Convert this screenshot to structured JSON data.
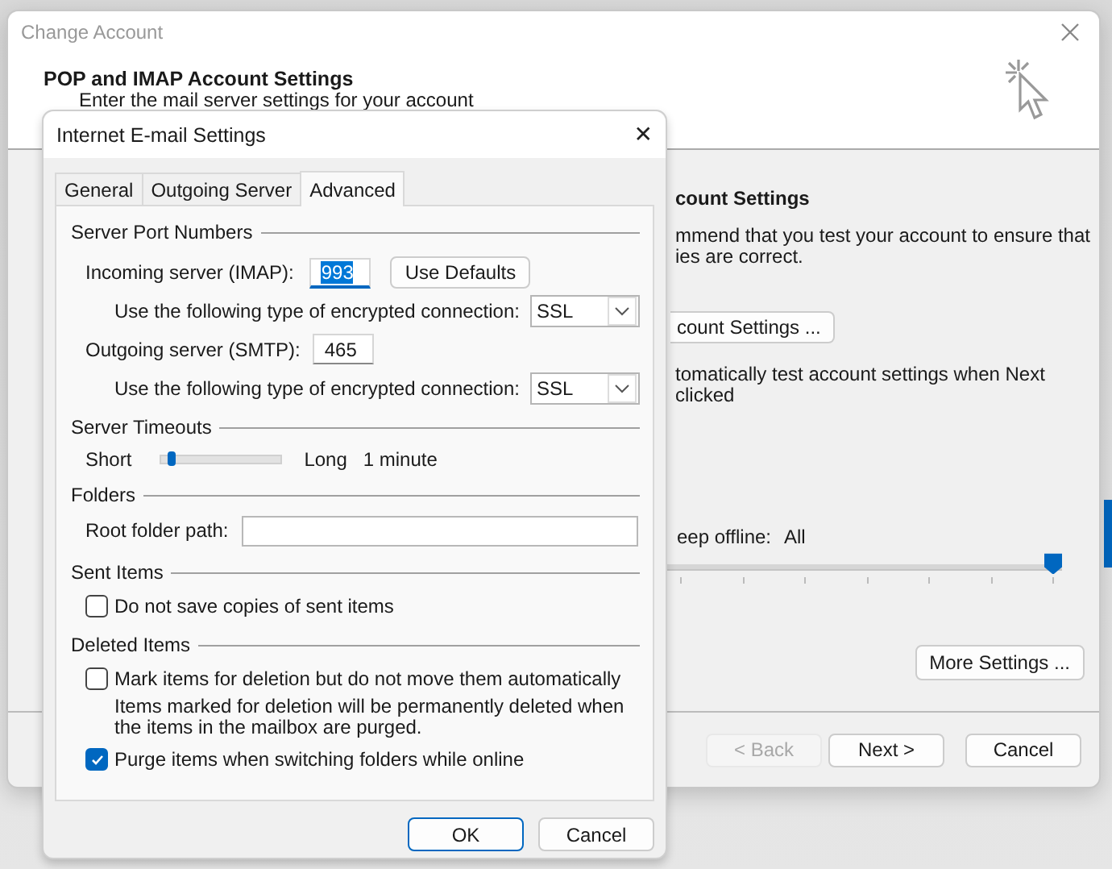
{
  "background_window": {
    "title": "Change Account",
    "heading": "POP and IMAP Account Settings",
    "subheading": "Enter the mail server settings for your account",
    "test_heading": "count Settings",
    "test_text": [
      "mmend that you test your account to ensure that",
      "ies are correct."
    ],
    "test_button": "count Settings ...",
    "auto_test_text": [
      "tomatically test account settings when Next",
      "clicked"
    ],
    "offline_label": "eep offline:",
    "offline_value": "All",
    "offline_slider": {
      "level": 1
    },
    "more_settings_button": "More Settings ...",
    "buttons": [
      {
        "label": "< Back",
        "disabled": true
      },
      {
        "label": "Next >",
        "disabled": false
      },
      {
        "label": "Cancel",
        "disabled": false
      }
    ]
  },
  "dialog": {
    "title": "Internet E-mail Settings",
    "close": "✕",
    "tabs": [
      {
        "label": "General",
        "selected": false
      },
      {
        "label": "Outgoing Server",
        "selected": false
      },
      {
        "label": "Advanced",
        "selected": true
      }
    ],
    "server_ports": {
      "heading": "Server Port Numbers",
      "incoming_label": "Incoming server (IMAP):",
      "incoming_port": {
        "value": "993",
        "highlighted": true
      },
      "use_defaults_button": "Use Defaults",
      "incoming_encryption_label": "Use the following type of encrypted connection:",
      "incoming_encryption": "SSL",
      "outgoing_label": "Outgoing server (SMTP):",
      "outgoing_port": {
        "value": "465",
        "highlighted": false
      },
      "outgoing_encryption_label": "Use the following type of encrypted connection:",
      "outgoing_encryption": "SSL"
    },
    "server_timeouts": {
      "heading": "Server Timeouts",
      "short_label": "Short",
      "long_label": "Long",
      "level": 0.1,
      "reading": "1 minute"
    },
    "folders": {
      "heading": "Folders",
      "root_folder_label": "Root folder path:"
    },
    "sent_items": {
      "heading": "Sent Items",
      "options": [
        {
          "label": "Do not save copies of sent items",
          "checked": false
        }
      ]
    },
    "deleted_items": {
      "heading": "Deleted Items",
      "options": [
        {
          "label": "Mark items for deletion but do not move them automatically",
          "checked": false,
          "note": [
            "Items marked for deletion will be permanently deleted when",
            "the items in the mailbox are purged."
          ]
        },
        {
          "label": "Purge items when switching folders while online",
          "checked": true
        }
      ]
    },
    "buttons": [
      {
        "label": "OK",
        "default": true
      },
      {
        "label": "Cancel",
        "default": false
      }
    ]
  }
}
